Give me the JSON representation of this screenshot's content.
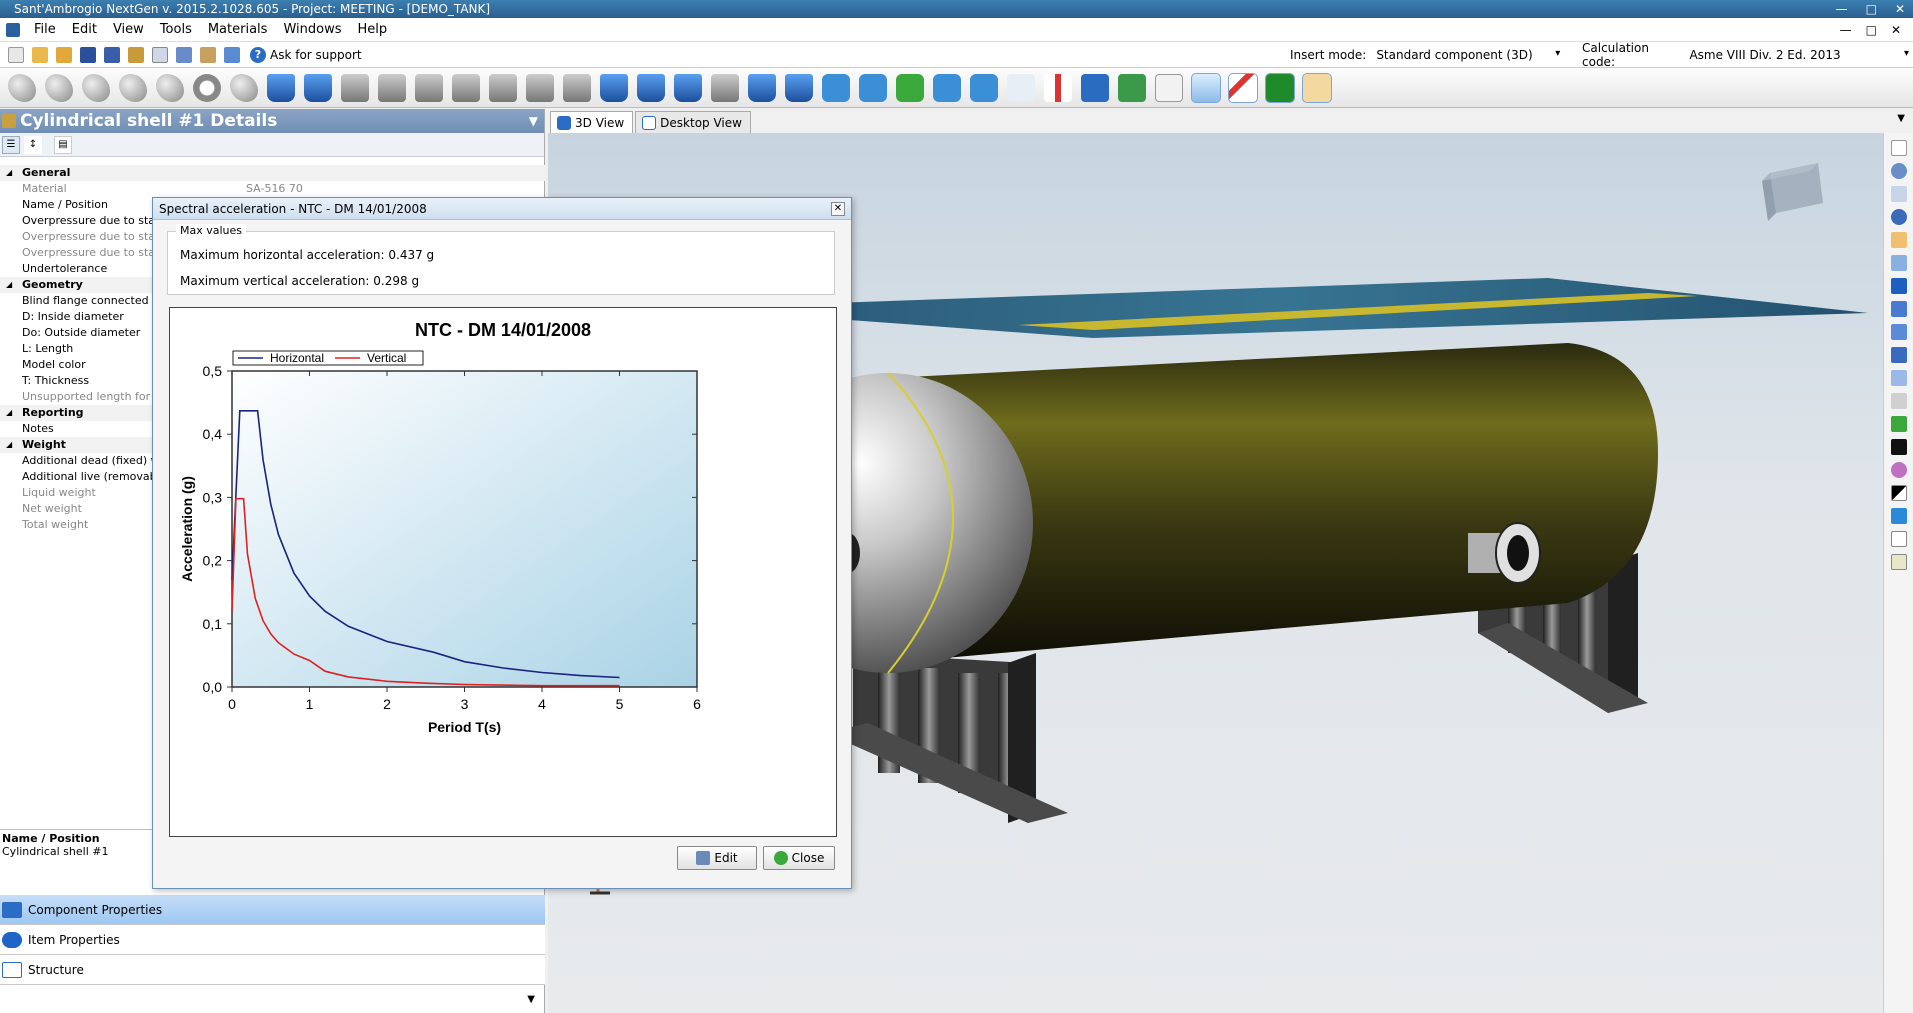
{
  "window": {
    "title": "Sant'Ambrogio NextGen  v. 2015.2.1028.605 - Project: MEETING - [DEMO_TANK]"
  },
  "menu": {
    "items": [
      "File",
      "Edit",
      "View",
      "Tools",
      "Materials",
      "Windows",
      "Help"
    ]
  },
  "quickbar": {
    "support_label": "Ask for support",
    "insert_mode_label": "Insert mode:",
    "insert_mode_value": "Standard component (3D)",
    "calc_code_label": "Calculation code:",
    "calc_code_value": "Asme VIII Div. 2 Ed. 2013"
  },
  "left_panel": {
    "title": "Cylindrical shell #1 Details",
    "properties": [
      {
        "name": "General",
        "value": "",
        "kind": "cat"
      },
      {
        "name": "Material",
        "value": "SA-516 70",
        "kind": "dis"
      },
      {
        "name": "Name / Position",
        "value": "",
        "kind": "row"
      },
      {
        "name": "Overpressure due to static",
        "value": "",
        "kind": "row"
      },
      {
        "name": "Overpressure due to static",
        "value": "",
        "kind": "dis"
      },
      {
        "name": "Overpressure due to static",
        "value": "",
        "kind": "dis"
      },
      {
        "name": "Undertolerance",
        "value": "",
        "kind": "row"
      },
      {
        "name": "Geometry",
        "value": "",
        "kind": "cat"
      },
      {
        "name": "Blind flange connected",
        "value": "",
        "kind": "row"
      },
      {
        "name": "D:  Inside diameter",
        "value": "",
        "kind": "row"
      },
      {
        "name": "Do:  Outside diameter",
        "value": "",
        "kind": "row"
      },
      {
        "name": "L:  Length",
        "value": "",
        "kind": "row"
      },
      {
        "name": "Model color",
        "value": "",
        "kind": "row"
      },
      {
        "name": "T:  Thickness",
        "value": "",
        "kind": "row"
      },
      {
        "name": "Unsupported length for ext",
        "value": "",
        "kind": "dis"
      },
      {
        "name": "Reporting",
        "value": "",
        "kind": "cat"
      },
      {
        "name": "Notes",
        "value": "",
        "kind": "row"
      },
      {
        "name": "Weight",
        "value": "",
        "kind": "cat"
      },
      {
        "name": "Additional dead (fixed) wei",
        "value": "",
        "kind": "row"
      },
      {
        "name": "Additional live (removable",
        "value": "",
        "kind": "row"
      },
      {
        "name": "Liquid weight",
        "value": "",
        "kind": "dis"
      },
      {
        "name": "Net weight",
        "value": "",
        "kind": "dis"
      },
      {
        "name": "Total weight",
        "value": "",
        "kind": "dis"
      }
    ],
    "desc_name": "Name / Position",
    "desc_value": "Cylindrical shell #1",
    "nav": [
      {
        "label": "Component Properties",
        "active": true
      },
      {
        "label": "Item Properties",
        "active": false
      },
      {
        "label": "Structure",
        "active": false
      }
    ]
  },
  "view_tabs": [
    {
      "label": "3D View",
      "active": true
    },
    {
      "label": "Desktop View",
      "active": false
    }
  ],
  "dialog": {
    "title": "Spectral acceleration - NTC - DM 14/01/2008",
    "max_values_legend": "Max values",
    "max_horizontal": "Maximum horizontal acceleration: 0.437 g",
    "max_vertical": "Maximum vertical acceleration: 0.298 g",
    "edit_label": "Edit",
    "close_label": "Close"
  },
  "chart_data": {
    "type": "line",
    "title": "NTC - DM 14/01/2008",
    "xlabel": "Period T(s)",
    "ylabel": "Acceleration (g)",
    "xlim": [
      0,
      6
    ],
    "ylim": [
      0,
      0.5
    ],
    "xticks": [
      "0",
      "1",
      "2",
      "3",
      "4",
      "5",
      "6"
    ],
    "yticks": [
      "0,0",
      "0,1",
      "0,2",
      "0,3",
      "0,4",
      "0,5"
    ],
    "legend_position": "top-left",
    "series": [
      {
        "name": "Horizontal",
        "color": "#1a237e",
        "x": [
          0,
          0.1,
          0.15,
          0.33,
          0.4,
          0.5,
          0.6,
          0.8,
          1.0,
          1.2,
          1.5,
          2.0,
          2.6,
          3.0,
          3.5,
          4.0,
          4.5,
          5.0
        ],
        "y": [
          0.17,
          0.437,
          0.437,
          0.437,
          0.36,
          0.289,
          0.241,
          0.18,
          0.144,
          0.12,
          0.096,
          0.072,
          0.055,
          0.04,
          0.03,
          0.023,
          0.018,
          0.015
        ]
      },
      {
        "name": "Vertical",
        "color": "#e02020",
        "x": [
          0,
          0.05,
          0.15,
          0.2,
          0.3,
          0.4,
          0.5,
          0.6,
          0.8,
          1.0,
          1.2,
          1.5,
          2.0,
          2.5,
          3.0,
          4.0,
          5.0
        ],
        "y": [
          0.12,
          0.298,
          0.298,
          0.21,
          0.14,
          0.105,
          0.084,
          0.07,
          0.052,
          0.042,
          0.025,
          0.016,
          0.009,
          0.006,
          0.004,
          0.002,
          0.002
        ]
      }
    ]
  }
}
